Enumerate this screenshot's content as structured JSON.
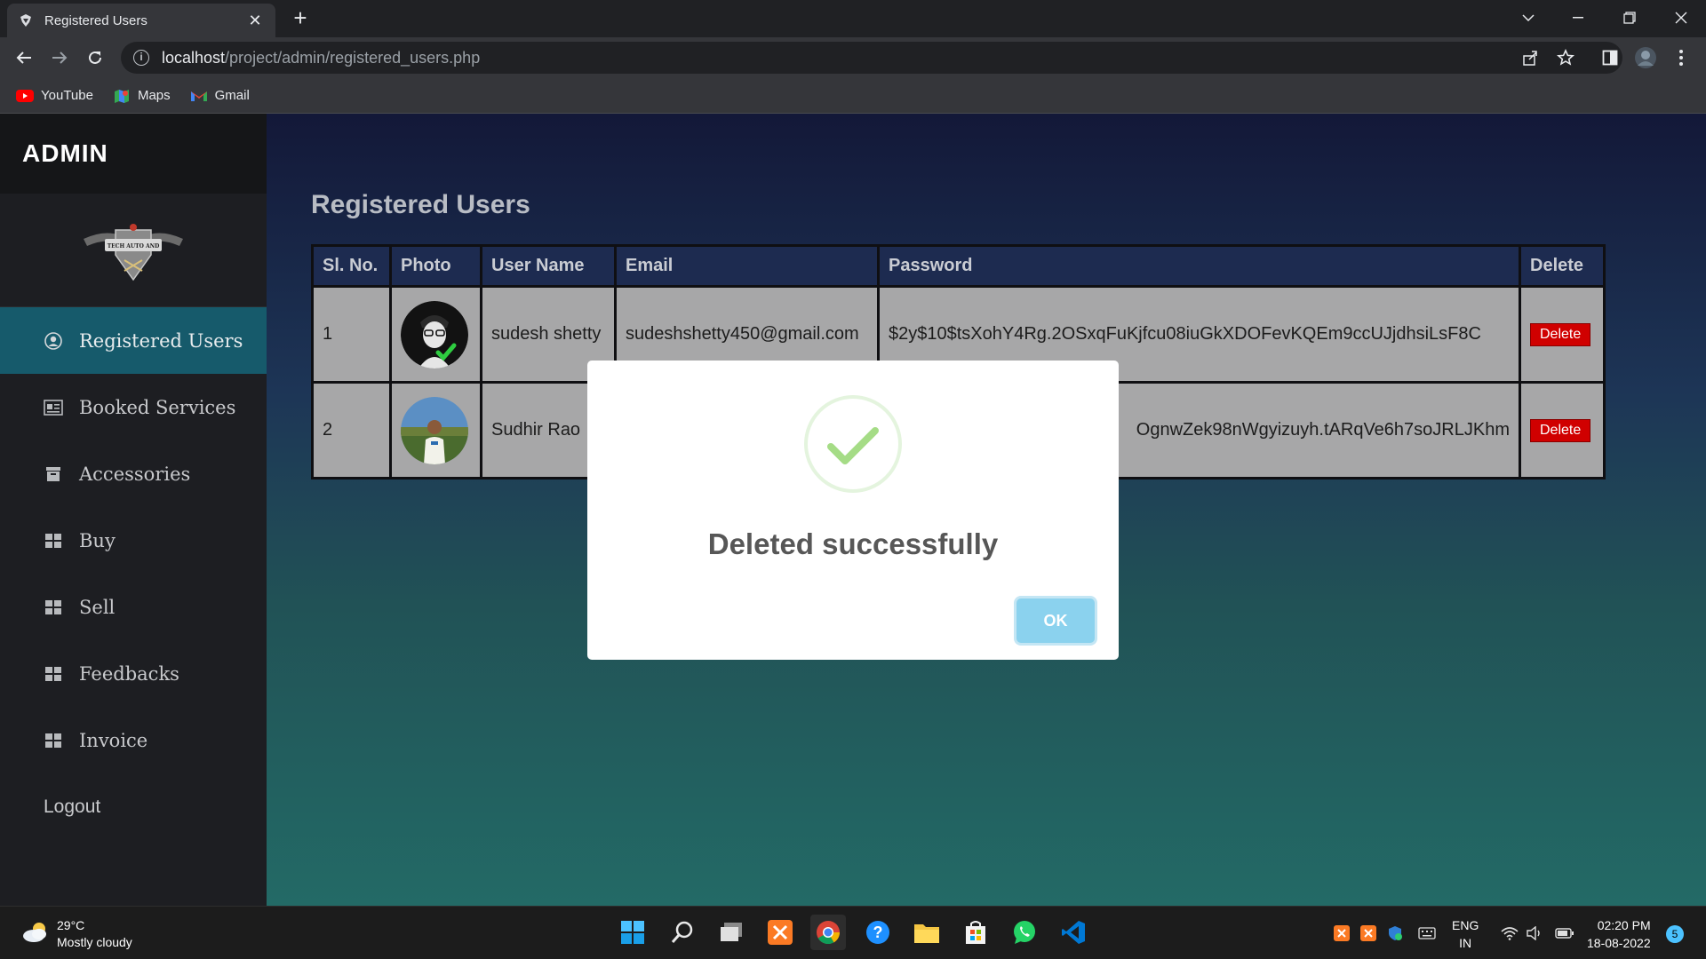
{
  "browser": {
    "tab_title": "Registered Users",
    "url_host": "localhost",
    "url_path": "/project/admin/registered_users.php",
    "bookmarks": [
      {
        "label": "YouTube",
        "icon": "youtube-icon"
      },
      {
        "label": "Maps",
        "icon": "maps-icon"
      },
      {
        "label": "Gmail",
        "icon": "gmail-icon"
      }
    ]
  },
  "sidebar": {
    "brand": "ADMIN",
    "logo_text": "TECH AUTO AND SERVICES",
    "items": [
      {
        "label": "Registered Users",
        "icon": "user-circle-icon",
        "active": true
      },
      {
        "label": "Booked Services",
        "icon": "id-card-icon",
        "active": false
      },
      {
        "label": "Accessories",
        "icon": "box-icon",
        "active": false
      },
      {
        "label": "Buy",
        "icon": "grid-icon",
        "active": false
      },
      {
        "label": "Sell",
        "icon": "grid-icon",
        "active": false
      },
      {
        "label": "Feedbacks",
        "icon": "grid-icon",
        "active": false
      },
      {
        "label": "Invoice",
        "icon": "grid-icon",
        "active": false
      }
    ],
    "logout": "Logout"
  },
  "main": {
    "title": "Registered Users",
    "table": {
      "headers": [
        "Sl. No.",
        "Photo",
        "User Name",
        "Email",
        "Password",
        "Delete"
      ],
      "rows": [
        {
          "sl": "1",
          "name": "sudesh shetty",
          "email": "sudeshshetty450@gmail.com",
          "password": "$2y$10$tsXohY4Rg.2OSxqFuKjfcu08iuGkXDOFevKQEm9ccUJjdhsiLsF8C",
          "delete": "Delete"
        },
        {
          "sl": "2",
          "name": "Sudhir Rao",
          "email": "",
          "password": "OgnwZek98nWgyizuyh.tARqVe6h7soJRLJKhm",
          "delete": "Delete"
        }
      ]
    }
  },
  "modal": {
    "message": "Deleted successfully",
    "ok_label": "OK",
    "colors": {
      "check": "#a5dc86",
      "ok_button": "#8bd2ee"
    }
  },
  "taskbar": {
    "weather_temp": "29°C",
    "weather_desc": "Mostly cloudy",
    "lang_line1": "ENG",
    "lang_line2": "IN",
    "time": "02:20 PM",
    "date": "18-08-2022",
    "notifications": "5"
  }
}
